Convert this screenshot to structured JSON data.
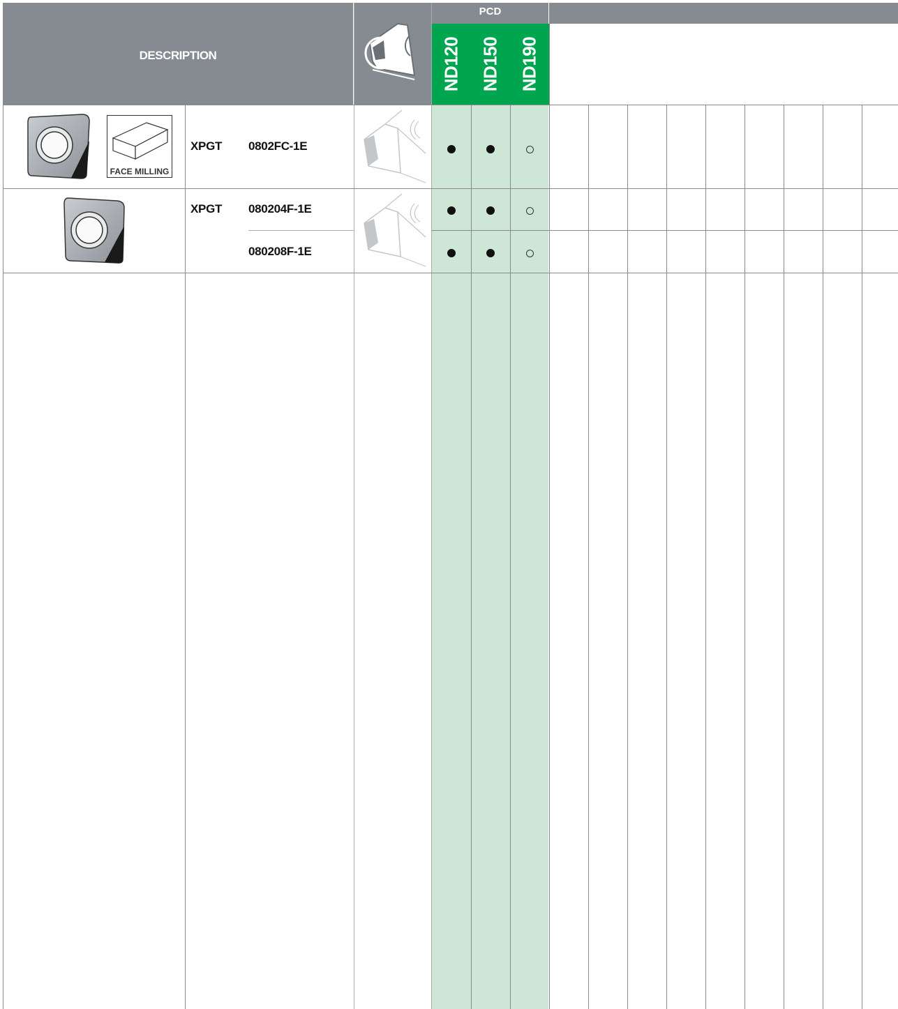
{
  "header": {
    "description_label": "DESCRIPTION",
    "group_label": "PCD",
    "grades": [
      "ND120",
      "ND150",
      "ND190"
    ]
  },
  "rows": [
    {
      "family": "XPGT",
      "code": "0802FC-1E",
      "application_label": "FACE MILLING",
      "marks": [
        "filled",
        "filled",
        "open"
      ]
    },
    {
      "family": "XPGT",
      "code": "080204F-1E",
      "marks": [
        "filled",
        "filled",
        "open"
      ]
    },
    {
      "family": "",
      "code": "080208F-1E",
      "marks": [
        "filled",
        "filled",
        "open"
      ]
    }
  ],
  "colors": {
    "header_gray": "#858b91",
    "grade_green": "#00a54f",
    "grade_column_tint": "#cde6d6"
  }
}
